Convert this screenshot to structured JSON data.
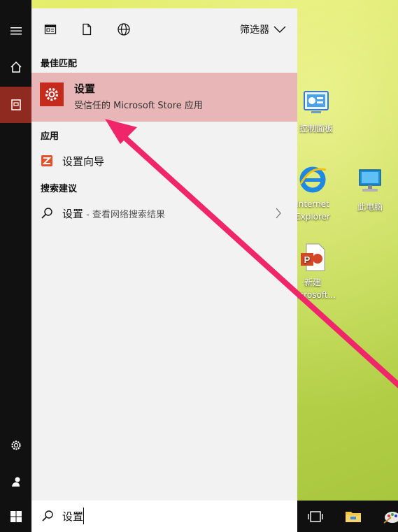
{
  "desktop": {
    "icons": [
      {
        "label": "控制面板"
      },
      {
        "label_line1": "Internet",
        "label_line2": "Explorer"
      },
      {
        "label": "此电脑"
      },
      {
        "label_line1": "新建",
        "label_line2": "Microsoft..."
      }
    ]
  },
  "start_menu": {
    "filter_label": "筛选器",
    "best_match_title": "最佳匹配",
    "best_match": {
      "title": "设置",
      "subtitle": "受信任的 Microsoft Store 应用"
    },
    "apps_title": "应用",
    "apps": [
      {
        "label": "设置向导"
      }
    ],
    "suggestions_title": "搜索建议",
    "suggestion": {
      "label": "设置",
      "sub": " - 查看网络搜索结果"
    }
  },
  "taskbar": {
    "search_value": "设置"
  },
  "colors": {
    "accent": "#c42b1c",
    "highlight": "#e8b6b6",
    "arrow": "#f0266a"
  }
}
